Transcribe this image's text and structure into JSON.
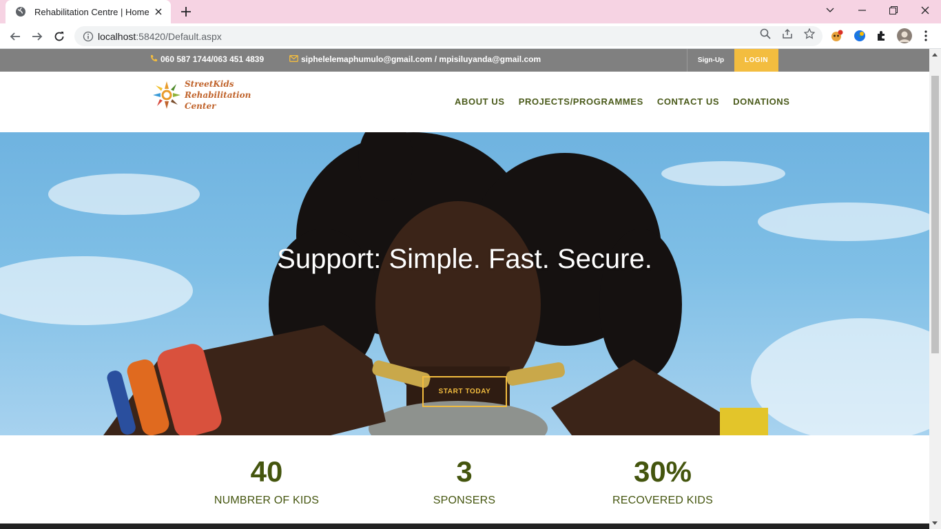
{
  "browser": {
    "tab_title": "Rehabilitation Centre | Home",
    "url_host": "localhost",
    "url_rest": ":58420/Default.aspx"
  },
  "topbar": {
    "phone": "060 587 1744/063 451 4839",
    "email": "siphelelemaphumulo@gmail.com / mpisiluyanda@gmail.com",
    "signup_label": "Sign-Up",
    "login_label": "LOGIN"
  },
  "logo": {
    "line1": "StreetKids",
    "line2": "Rehabilitation",
    "line3": "Center"
  },
  "nav": {
    "items": [
      {
        "label": "ABOUT US"
      },
      {
        "label": "PROJECTS/PROGRAMMES"
      },
      {
        "label": "CONTACT US"
      },
      {
        "label": "DONATIONS"
      }
    ]
  },
  "hero": {
    "headline": "Support: Simple. Fast. Secure.",
    "cta_label": "START TODAY"
  },
  "stats": [
    {
      "value": "40",
      "label": "NUMBRER OF KIDS"
    },
    {
      "value": "3",
      "label": "SPONSERS"
    },
    {
      "value": "30%",
      "label": "RECOVERED KIDS"
    }
  ],
  "colors": {
    "accent": "#f3bd3f",
    "nav_text": "#4a5a1a",
    "stat_text": "#44550e",
    "topbar_bg": "#808080",
    "tabbar_bg": "#f6d3e3"
  }
}
